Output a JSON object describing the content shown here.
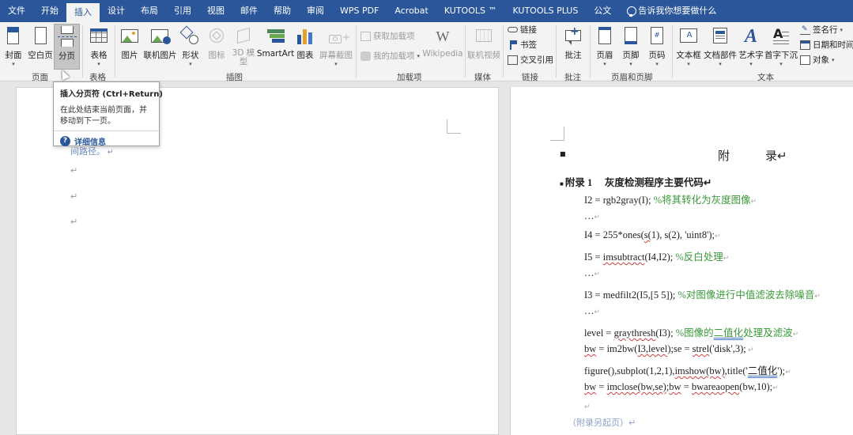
{
  "tabs": [
    "文件",
    "开始",
    "插入",
    "设计",
    "布局",
    "引用",
    "视图",
    "邮件",
    "帮助",
    "审阅",
    "WPS PDF",
    "Acrobat",
    "KUTOOLS ™",
    "KUTOOLS PLUS",
    "公文"
  ],
  "active_tab": "插入",
  "tell_me": "告诉我你想要做什么",
  "ribbon": {
    "pages": {
      "cover": "封面",
      "blank": "空白页",
      "break": "分页",
      "group": "页面"
    },
    "table": {
      "table": "表格",
      "group": "表格"
    },
    "illustrations": {
      "picture": "图片",
      "online_picture": "联机图片",
      "shapes": "形状",
      "icons": "图标",
      "model_3d": "3D 模型",
      "smartart": "SmartArt",
      "chart": "图表",
      "screenshot": "屏幕截图",
      "group": "插图"
    },
    "addins": {
      "get": "获取加载项",
      "my": "我的加载项",
      "wikipedia": "Wikipedia",
      "group": "加载项"
    },
    "media": {
      "online_video": "联机视频",
      "group": "媒体"
    },
    "links": {
      "link": "链接",
      "bookmark": "书签",
      "cross_ref": "交叉引用",
      "group": "链接"
    },
    "comments": {
      "comment": "批注",
      "group": "批注"
    },
    "header_footer": {
      "header": "页眉",
      "footer": "页脚",
      "page_number": "页码",
      "group": "页眉和页脚"
    },
    "text": {
      "textbox": "文本框",
      "quick_parts": "文档部件",
      "wordart": "艺术字",
      "dropcap": "首字下沉",
      "signature": "签名行",
      "datetime": "日期和时间",
      "object": "对象",
      "group": "文本"
    }
  },
  "tooltip": {
    "title": "插入分页符 (Ctrl+Return)",
    "desc": "在此处结束当前页面，并移动到下一页。",
    "more": "详细信息"
  },
  "left_page": {
    "partial_text": "间路径。"
  },
  "right_page": {
    "heading": "附　　　录",
    "subheading_num": "附录 1",
    "subheading_title": "灰度检测程序主要代码",
    "lines": {
      "l1_code": "I2 = rgb2gray(I); ",
      "l1_comment": "%将其转化为灰度图像",
      "l2": "…",
      "l3_pre": "I4 = 255*ones(",
      "l3_sq": "s(",
      "l3_post": "1), s(2), 'uint8');",
      "l4_pre": "I5 = ",
      "l4_sq": "imsubtract",
      "l4_post": "(I4,I2); ",
      "l4_comment": "%反白处理",
      "l5": "…",
      "l6_code": "I3 = medfilt2(I5,[5 5]); ",
      "l6_comment": "%对图像进行中值滤波去除噪音",
      "l7": "…",
      "l8_pre": "level = ",
      "l8_sq": "graythresh",
      "l8_post": "(I3); ",
      "l8_c1": "%图像的",
      "l8_c2": "二值化",
      "l8_c3": "处理及滤波",
      "l9_sq1": "bw",
      "l9_mid": " = im2bw(",
      "l9_sq2": "I3,level",
      "l9_mid2": ");se = ",
      "l9_sq3": "strel",
      "l9_post": "('disk',3);",
      "l10_pre": "figure(),subplot(1,2,1),",
      "l10_sq": "imshow(bw)",
      "l10_mid": ",title('",
      "l10_dq": "二值化",
      "l10_post": "');",
      "l11_sq1": "bw",
      "l11_mid": " = ",
      "l11_sq2": "imclose(bw,se)",
      "l11_mid2": ";",
      "l11_sq3": "bw",
      "l11_mid3": " = ",
      "l11_sq4": "bwareaopen",
      "l11_post": "(bw,10);",
      "footer_note": "（附录另起页）"
    }
  },
  "colors": {
    "accent": "#2b579a",
    "comment_green": "#3a9a3a",
    "ribbon_bg": "#f3f3f3"
  }
}
